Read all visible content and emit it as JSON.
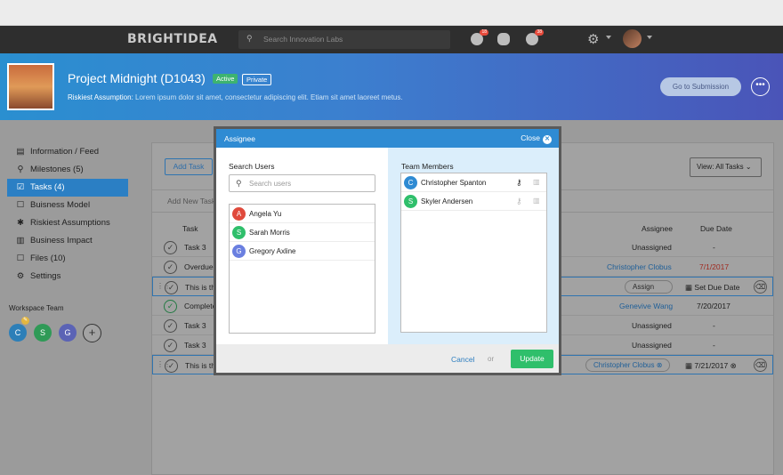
{
  "nav": {
    "brand": "BRIGHTIDEA",
    "search_placeholder": "Search Innovation Labs",
    "badge_1": "18",
    "badge_2": "38"
  },
  "hero": {
    "title": "Project Midnight (D1043)",
    "status": "Active",
    "visibility": "Private",
    "assumption_label": "Riskiest Assumption:",
    "assumption_text": " Lorem ipsum dolor sit amet, consectetur adipiscing elit. Etiam sit amet laoreet metus.",
    "submit_button": "Go to Submission",
    "more_button": "•••"
  },
  "sidebar": {
    "items": [
      {
        "label": "Information / Feed",
        "icon": "▤"
      },
      {
        "label": "Milestones (5)",
        "icon": "⚲"
      },
      {
        "label": "Tasks (4)",
        "icon": "☑"
      },
      {
        "label": "Buisness Model",
        "icon": "☐"
      },
      {
        "label": "Riskiest Assumptions",
        "icon": "✱"
      },
      {
        "label": "Business Impact",
        "icon": "▥"
      },
      {
        "label": "Files (10)",
        "icon": "☐"
      },
      {
        "label": "Settings",
        "icon": "⚙"
      }
    ],
    "workspace_label": "Workspace Team",
    "team": [
      {
        "initial": "C",
        "color": "#2d7fb8"
      },
      {
        "initial": "S",
        "color": "#2f9a57"
      },
      {
        "initial": "G",
        "color": "#5b63b5"
      }
    ],
    "badge": "✎",
    "add": "+"
  },
  "tasks": {
    "add_button": "Add Task",
    "view_select": "View: All Tasks",
    "add_new_placeholder": "Add New Task",
    "col_task": "Task",
    "col_assignee": "Assignee",
    "col_due": "Due Date",
    "rows": [
      {
        "name": "Task 3",
        "assignee": "Unassigned",
        "due": "-"
      },
      {
        "name": "Overdue T",
        "assignee": "Christopher Clobus",
        "due": "7/1/2017"
      },
      {
        "name": "This is the",
        "assignee": "Assign",
        "due": "Set Due Date"
      },
      {
        "name": "Complete",
        "assignee": "Genevive Wang",
        "due": "7/20/2017"
      },
      {
        "name": "Task 3",
        "assignee": "Unassigned",
        "due": "-"
      },
      {
        "name": "Task 3",
        "assignee": "Unassigned",
        "due": "-"
      },
      {
        "name": "This is the",
        "assignee": "Christopher Clobus",
        "due": "7/21/2017"
      }
    ]
  },
  "modal": {
    "title": "Assignee",
    "close": "Close",
    "search_label": "Search Users",
    "search_placeholder": "Search users",
    "users": [
      {
        "name": "Angela Yu",
        "initial": "A",
        "color": "#e04a3c"
      },
      {
        "name": "Sarah Morris",
        "initial": "S",
        "color": "#2fbf6b"
      },
      {
        "name": "Gregory Axline",
        "initial": "G",
        "color": "#6a7fe0"
      }
    ],
    "members_label": "Team Members",
    "members": [
      {
        "name": "Christopher Spanton",
        "initial": "C",
        "color": "#2f8bd3"
      },
      {
        "name": "Skyler Andersen",
        "initial": "S",
        "color": "#2fbf6b"
      }
    ],
    "cancel": "Cancel",
    "or": "or",
    "update": "Update"
  }
}
